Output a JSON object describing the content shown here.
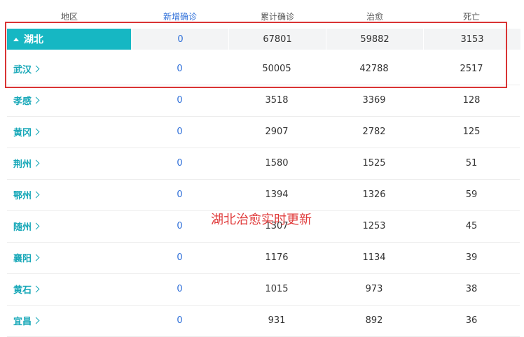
{
  "header": {
    "region": "地区",
    "new_confirmed": "新增确诊",
    "total_confirmed": "累计确诊",
    "cured": "治愈",
    "deaths": "死亡"
  },
  "province": {
    "name": "湖北",
    "new": "0",
    "total": "67801",
    "cured": "59882",
    "deaths": "3153"
  },
  "cities": [
    {
      "name": "武汉",
      "new": "0",
      "total": "50005",
      "cured": "42788",
      "deaths": "2517"
    },
    {
      "name": "孝感",
      "new": "0",
      "total": "3518",
      "cured": "3369",
      "deaths": "128"
    },
    {
      "name": "黄冈",
      "new": "0",
      "total": "2907",
      "cured": "2782",
      "deaths": "125"
    },
    {
      "name": "荆州",
      "new": "0",
      "total": "1580",
      "cured": "1525",
      "deaths": "51"
    },
    {
      "name": "鄂州",
      "new": "0",
      "total": "1394",
      "cured": "1326",
      "deaths": "59"
    },
    {
      "name": "随州",
      "new": "0",
      "total": "1307",
      "cured": "1253",
      "deaths": "45"
    },
    {
      "name": "襄阳",
      "new": "0",
      "total": "1176",
      "cured": "1134",
      "deaths": "39"
    },
    {
      "name": "黄石",
      "new": "0",
      "total": "1015",
      "cured": "973",
      "deaths": "38"
    },
    {
      "name": "宜昌",
      "new": "0",
      "total": "931",
      "cured": "892",
      "deaths": "36"
    }
  ],
  "annotation": "湖北治愈实时更新",
  "colors": {
    "accent": "#16b7c3",
    "new_text": "#2e6fd9",
    "annotation": "#e03a3a"
  }
}
